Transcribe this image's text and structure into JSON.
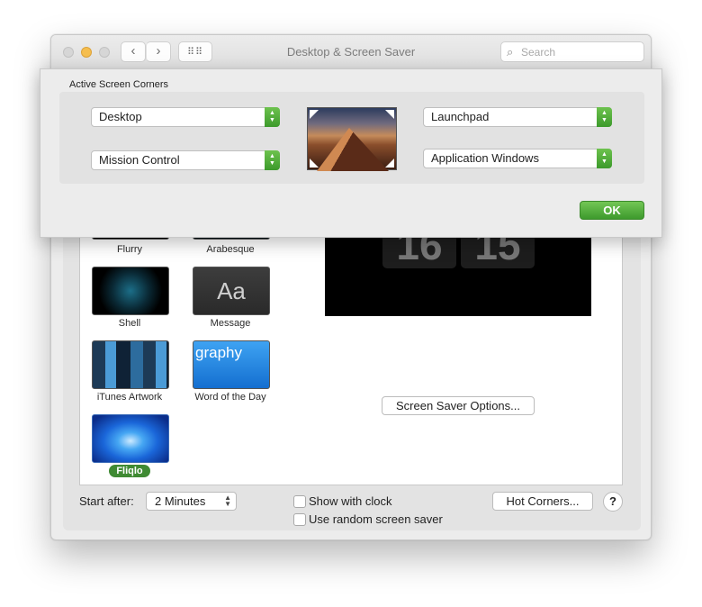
{
  "window": {
    "title": "Desktop & Screen Saver"
  },
  "search": {
    "placeholder": "Search"
  },
  "savers": [
    {
      "label": "Flurry"
    },
    {
      "label": "Arabesque"
    },
    {
      "label": "Shell"
    },
    {
      "label": "Message",
      "glyph": "Aa"
    },
    {
      "label": "iTunes Artwork"
    },
    {
      "label": "Word of the Day",
      "glyph": "graphy"
    },
    {
      "label": "Fliqlo",
      "selected": true
    }
  ],
  "clock": {
    "hours": "16",
    "minutes": "15"
  },
  "buttons": {
    "screen_saver_options": "Screen Saver Options...",
    "hot_corners": "Hot Corners...",
    "help": "?",
    "ok": "OK"
  },
  "start_after": {
    "label": "Start after:",
    "value": "2 Minutes"
  },
  "checkboxes": {
    "show_with_clock": {
      "label": "Show with clock",
      "checked": false
    },
    "random_saver": {
      "label": "Use random screen saver",
      "checked": false
    }
  },
  "sheet": {
    "title": "Active Screen Corners",
    "top_left": "Desktop",
    "bottom_left": "Mission Control",
    "top_right": "Launchpad",
    "bottom_right": "Application Windows"
  },
  "colors": {
    "accent_green": "#3f8a33",
    "traffic_minimize": "#f5be4f"
  }
}
